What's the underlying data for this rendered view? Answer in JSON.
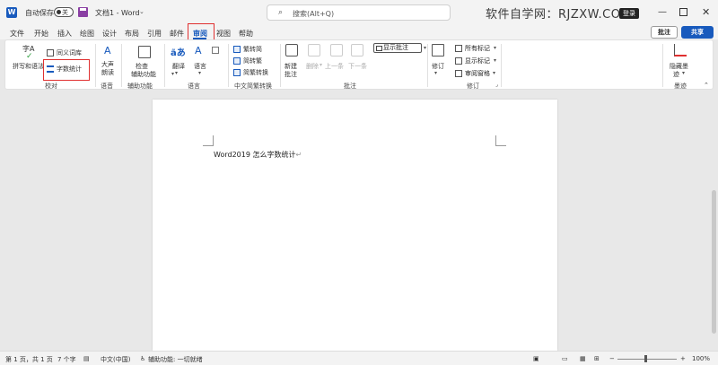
{
  "titlebar": {
    "autosave_label": "自动保存",
    "toggle_text": "关",
    "doc_title": "文档1  -  Word",
    "search_placeholder": "搜索(Alt+Q)",
    "watermark": "软件自学网：RJZXW.COM",
    "login": "登录"
  },
  "tabs": [
    "文件",
    "开始",
    "插入",
    "绘图",
    "设计",
    "布局",
    "引用",
    "邮件",
    "审阅",
    "视图",
    "帮助"
  ],
  "active_tab": "审阅",
  "top_right": {
    "comment": "批注",
    "share": "共享"
  },
  "ribbon": {
    "proofing": {
      "spell": "拼写和语法",
      "spell_icon_text": "字A",
      "thesaurus": "同义词库",
      "word_count": "字数统计",
      "label": "校对"
    },
    "speech": {
      "read_aloud_1": "大声",
      "read_aloud_2": "朗读",
      "label": "语音"
    },
    "accessibility": {
      "check_1": "检查",
      "check_2": "辅助功能",
      "label": "辅助功能"
    },
    "language": {
      "translate": "翻译",
      "language": "语言",
      "label": "语言"
    },
    "chinese_conv": {
      "trad": "繁转简",
      "simp": "简转繁",
      "conv": "简繁转换",
      "label": "中文简繁转换"
    },
    "comments": {
      "new_1": "新建",
      "new_2": "批注",
      "delete": "删除",
      "prev": "上一条",
      "next": "下一条",
      "show": "显示批注",
      "label": "批注"
    },
    "tracking": {
      "track": "修订",
      "all_markup": "所有标记",
      "show_markup": "显示标记",
      "review_pane": "审阅窗格",
      "label": "修订"
    },
    "ink": {
      "hide_1": "隐藏墨",
      "hide_2": "迹",
      "label": "墨迹"
    }
  },
  "document": {
    "text": "Word2019 怎么字数统计",
    "pilcrow": "↵"
  },
  "statusbar": {
    "page": "第 1 页，共 1 页",
    "words": "7 个字",
    "language": "中文(中国)",
    "accessibility": "辅助功能: 一切就绪",
    "zoom": "100%"
  },
  "colors": {
    "accent": "#185abd",
    "highlight": "#e03030"
  }
}
